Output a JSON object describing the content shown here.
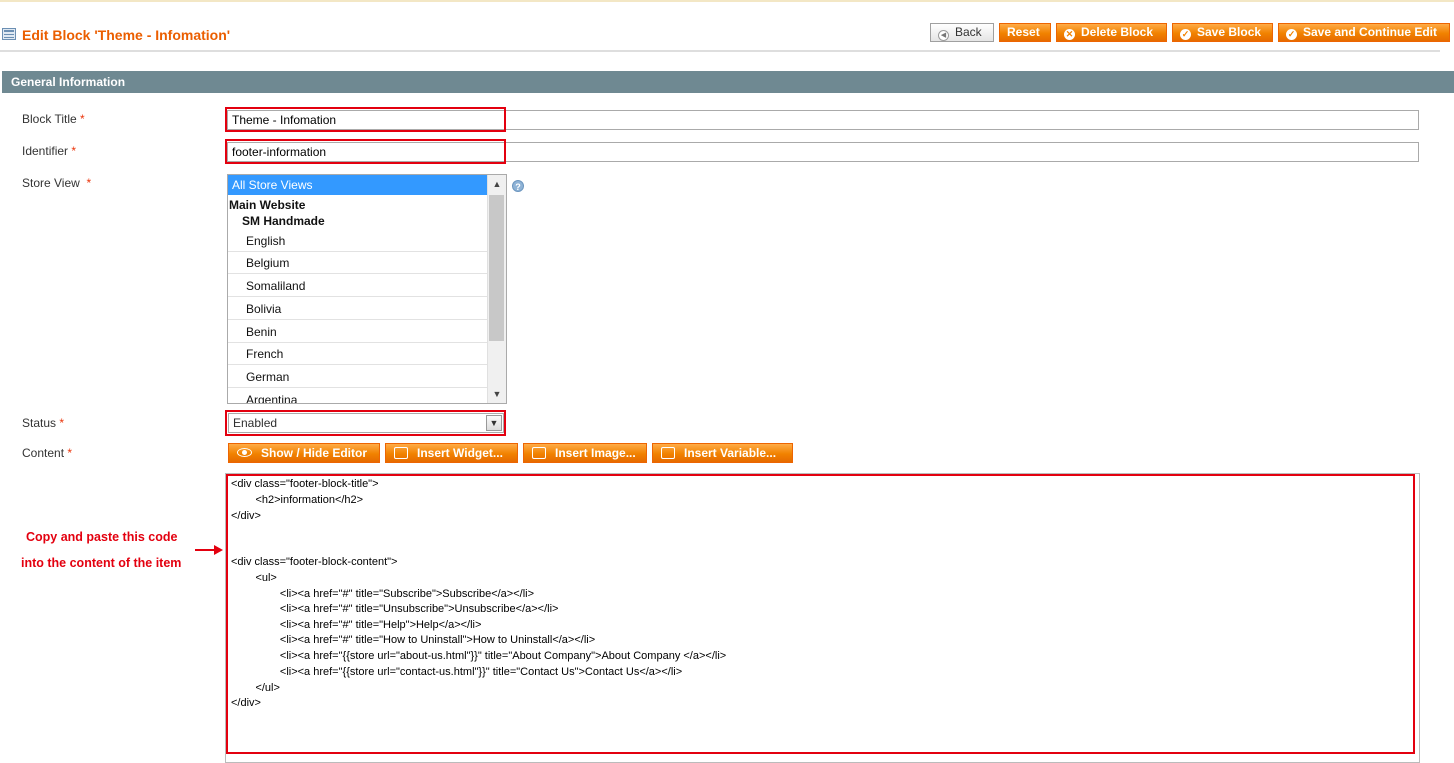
{
  "header": {
    "title": "Edit Block 'Theme - Infomation'",
    "buttons": {
      "back": "Back",
      "reset": "Reset",
      "delete": "Delete Block",
      "save": "Save Block",
      "save_continue": "Save and Continue Edit"
    }
  },
  "section": {
    "title": "General Information"
  },
  "form": {
    "block_title": {
      "label": "Block Title",
      "value": "Theme - Infomation"
    },
    "identifier": {
      "label": "Identifier",
      "value": "footer-information"
    },
    "store_view": {
      "label": "Store View",
      "selected": "All Store Views",
      "group": "Main Website",
      "store": "SM Handmade",
      "options": [
        "English",
        "Belgium",
        "Somaliland",
        "Bolivia",
        "Benin",
        "French",
        "German",
        "Argentina"
      ]
    },
    "status": {
      "label": "Status",
      "value": "Enabled"
    },
    "content": {
      "label": "Content",
      "buttons": {
        "show_hide": "Show / Hide Editor",
        "insert_widget": "Insert Widget...",
        "insert_image": "Insert Image...",
        "insert_variable": "Insert Variable..."
      },
      "code_lines": [
        "<div class=\"footer-block-title\">",
        "        <h2>information</h2>",
        "</div>",
        "",
        "",
        "<div class=\"footer-block-content\">",
        "        <ul>",
        "                <li><a href=\"#\" title=\"Subscribe\">Subscribe</a></li>",
        "                <li><a href=\"#\" title=\"Unsubscribe\">Unsubscribe</a></li>",
        "                <li><a href=\"#\" title=\"Help\">Help</a></li>",
        "                <li><a href=\"#\" title=\"How to Uninstall\">How to Uninstall</a></li>",
        "                <li><a href=\"{{store url=\"about-us.html\"}}\" title=\"About Company\">About Company </a></li>",
        "                <li><a href=\"{{store url=\"contact-us.html\"}}\" title=\"Contact Us\">Contact Us</a></li>",
        "        </ul>",
        "</div>"
      ]
    }
  },
  "annotation": {
    "line1": "Copy and paste this code",
    "line2": "into the content of the item"
  },
  "required_mark": "*",
  "help_glyph": "?",
  "colors": {
    "accent": "#eb5e00",
    "highlight": "#e3000f",
    "section": "#6f8992",
    "selection": "#3399ff"
  }
}
